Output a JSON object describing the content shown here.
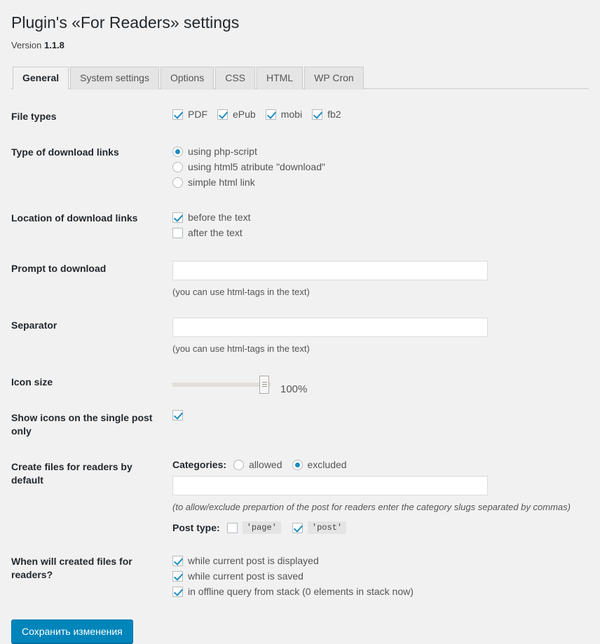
{
  "header": {
    "title": "Plugin's «For Readers» settings",
    "version_label": "Version",
    "version_number": "1.1.8"
  },
  "tabs": [
    {
      "label": "General",
      "active": true
    },
    {
      "label": "System settings",
      "active": false
    },
    {
      "label": "Options",
      "active": false
    },
    {
      "label": "CSS",
      "active": false
    },
    {
      "label": "HTML",
      "active": false
    },
    {
      "label": "WP Cron",
      "active": false
    }
  ],
  "sections": {
    "file_types": {
      "label": "File types",
      "options": [
        {
          "label": "PDF",
          "checked": true
        },
        {
          "label": "ePub",
          "checked": true
        },
        {
          "label": "mobi",
          "checked": true
        },
        {
          "label": "fb2",
          "checked": true
        }
      ]
    },
    "link_type": {
      "label": "Type of download links",
      "options": [
        {
          "label": "using php-script",
          "checked": true
        },
        {
          "label": "using html5 atribute \"download\"",
          "checked": false
        },
        {
          "label": "simple html link",
          "checked": false
        }
      ]
    },
    "link_location": {
      "label": "Location of download links",
      "options": [
        {
          "label": "before the text",
          "checked": true
        },
        {
          "label": "after the text",
          "checked": false
        }
      ]
    },
    "prompt": {
      "label": "Prompt to download",
      "value": "",
      "placeholder": "",
      "hint": "(you can use html-tags in the text)"
    },
    "separator": {
      "label": "Separator",
      "value": "",
      "placeholder": "",
      "hint": "(you can use html-tags in the text)"
    },
    "icon_size": {
      "label": "Icon size",
      "value": "100%"
    },
    "single_post": {
      "label": "Show icons on the single post only",
      "checked": true
    },
    "create_files": {
      "label": "Create files for readers by default",
      "categories_label": "Categories:",
      "categories_options": [
        {
          "label": "allowed",
          "checked": false
        },
        {
          "label": "excluded",
          "checked": true
        }
      ],
      "categories_value": "",
      "categories_placeholder": "",
      "categories_hint": "(to allow/exclude prepartion of the post for readers enter the category slugs separated by commas)",
      "post_type_label": "Post type:",
      "post_type_options": [
        {
          "label": "'page'",
          "checked": false
        },
        {
          "label": "'post'",
          "checked": true
        }
      ]
    },
    "when_created": {
      "label": "When will created files for readers?",
      "options": [
        {
          "label": "while current post is displayed",
          "checked": true
        },
        {
          "label": "while current post is saved",
          "checked": true
        },
        {
          "label": "in offline query from stack  (0 elements in stack now)",
          "checked": true
        }
      ]
    }
  },
  "submit": {
    "label": "Сохранить изменения"
  },
  "colors": {
    "accent": "#0085ba",
    "control": "#1e8cbe",
    "background": "#f1f1f1",
    "label": "#23282d"
  }
}
